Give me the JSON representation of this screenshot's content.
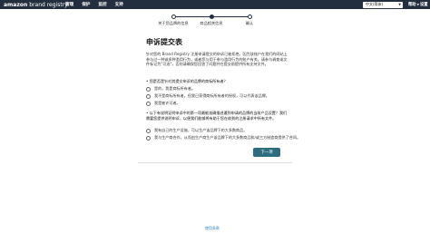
{
  "header": {
    "logo_main": "amazon",
    "logo_sub": "brand registry",
    "nav": [
      "管理",
      "保护",
      "监控",
      "支持"
    ],
    "language": "中文(简体)",
    "help": "帮助",
    "settings": "设置"
  },
  "stepper": {
    "steps": [
      "关于您品牌的信息",
      "商品相关信息",
      "确认"
    ],
    "current_step": 2
  },
  "form": {
    "title": "申诉提交表",
    "description": "针对您的 Brand Registry 注册申请提交的申诉已被拒绝。因为该账户在我们的网站上参与过一种或多种滥用行为，或者您与用于参与滥用行为的账户有关。请参与调查或文件标记为\"可选\"，否则请确保您回答了问题并在提交前提供所有支持文件。",
    "question1": "• 您是否是针对其提交申诉的品牌的商标所有者？",
    "q1_options": [
      "是的，我是商标所有者。",
      "我不是商标所有者，但我已获得商标所有者的授权，可以代表该品牌。",
      "我是被许可者。"
    ],
    "question2": "• 以下有说明证明申诉中的第一项最能准确描述遭到申请的品牌的当前产品设置？我们需要您提供说明申诉，以便我们能够将有助于您在收到的注册请求中所有文件。",
    "q2_options": [
      "我有自己的生产设施，可以生产该品牌下的大多数商品。",
      "我与生产商合作，从而由生产商生产该品牌下的大多数商品和/或三方制造商提供了合同。"
    ],
    "next_label": "下一项"
  },
  "footer": {
    "link": "使用条款"
  }
}
